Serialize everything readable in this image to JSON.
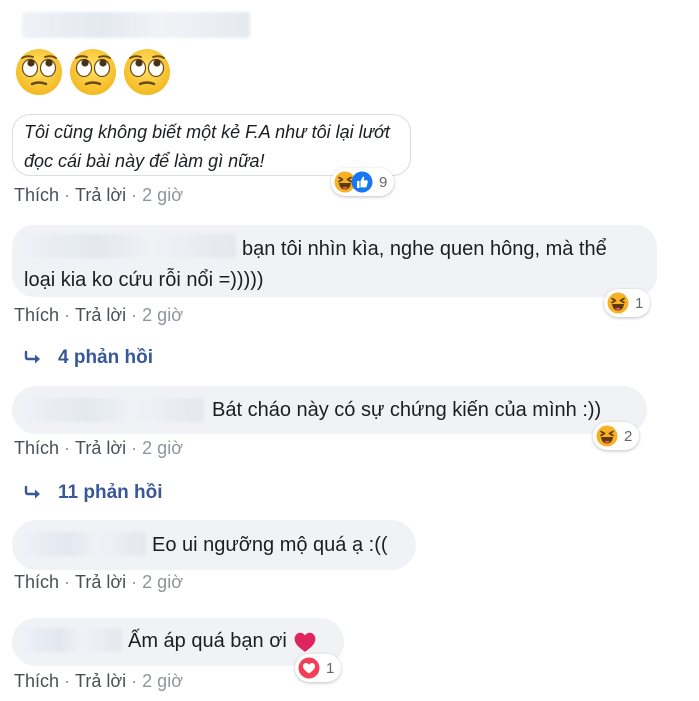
{
  "emojis": [
    "face-with-rolling-eyes-icon",
    "face-with-rolling-eyes-icon",
    "face-with-rolling-eyes-icon"
  ],
  "colors": {
    "bubble": "#f0f2f5",
    "link": "#385898",
    "meta": "#90949c",
    "heart": "#f33e58",
    "haha": "#f7b125",
    "like": "#1877f2"
  },
  "actions": {
    "like": "Thích",
    "reply": "Trả lời",
    "time": "2 giờ",
    "sep": "·"
  },
  "comments": [
    {
      "text_lines": [
        "Tôi cũng không biết một kẻ F.A như tôi lại lướt",
        "đọc cái bài này để làm gì nữa!"
      ],
      "reaction_icons": [
        "haha-icon",
        "like-icon"
      ],
      "reaction_count": "9"
    },
    {
      "text_lines": [
        "bạn tôi nhìn kìa, nghe quen hông, mà thể",
        "loại kia ko cứu rỗi nổi =)))))"
      ],
      "reaction_icons": [
        "haha-icon"
      ],
      "reaction_count": "1",
      "replies": "4 phản hồi"
    },
    {
      "text_lines": [
        "Bát cháo này có sự chứng kiến của mình :))"
      ],
      "reaction_icons": [
        "haha-icon"
      ],
      "reaction_count": "2",
      "replies": "11 phản hồi"
    },
    {
      "text_lines": [
        "Eo ui ngưỡng mộ quá ạ :(("
      ]
    },
    {
      "text_lines": [
        "Ấm áp quá bạn ơi"
      ],
      "inline_emoji": "red-heart-icon",
      "reaction_icons": [
        "heart-icon"
      ],
      "reaction_count": "1"
    }
  ]
}
